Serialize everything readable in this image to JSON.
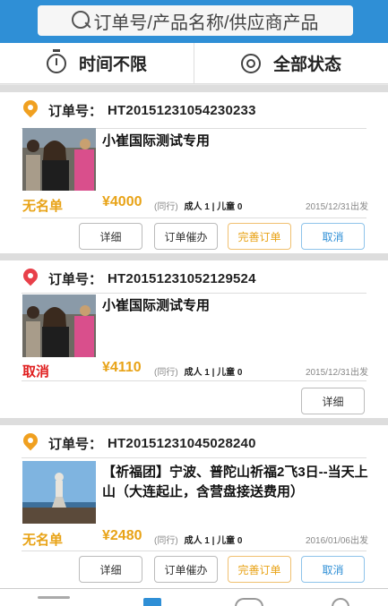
{
  "search": {
    "placeholder": "订单号/产品名称/供应商产品"
  },
  "filters": {
    "time": "时间不限",
    "status": "全部状态"
  },
  "colors": {
    "brand": "#2f8fd6",
    "accent": "#e8a317",
    "cancel": "#e02020",
    "pin_orange": "#f0a020",
    "pin_red": "#e8404a"
  },
  "orders": [
    {
      "label": "订单号：",
      "number": "HT20151231054230233",
      "product": "小崔国际测试专用",
      "status": "无名单",
      "price": "¥4000",
      "tag": "(同行)",
      "people": "成人 1 | 儿童 0",
      "date": "2015/12/31出发",
      "buttons": [
        "详细",
        "订单催办",
        "完善订单",
        "取消"
      ]
    },
    {
      "label": "订单号：",
      "number": "HT20151231052129524",
      "product": "小崔国际测试专用",
      "status": "取消",
      "price": "¥4110",
      "tag": "(同行)",
      "people": "成人 1 | 儿童 0",
      "date": "2015/12/31出发",
      "buttons": [
        "详细"
      ]
    },
    {
      "label": "订单号：",
      "number": "HT20151231045028240",
      "product": "【祈福团】宁波、普陀山祈福2飞3日--当天上山（大连起止，含营盘接送费用）",
      "status": "无名单",
      "price": "¥2480",
      "tag": "(同行)",
      "people": "成人 1 | 儿童 0",
      "date": "2016/01/06出发",
      "buttons": [
        "详细",
        "订单催办",
        "完善订单",
        "取消"
      ]
    }
  ]
}
